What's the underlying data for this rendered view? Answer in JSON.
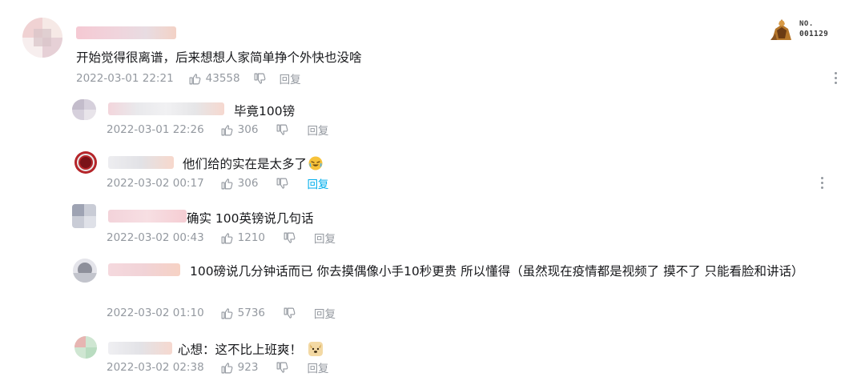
{
  "icons": {
    "like": "thumbs-up-icon",
    "dislike": "thumbs-down-icon",
    "more": "more-vertical-icon"
  },
  "colors": {
    "meta_gray": "#9499a0",
    "reply_hover": "#00aeec",
    "text": "#18191c"
  },
  "fan_badge": {
    "no_label": "NO.",
    "number": "001129"
  },
  "main_comment": {
    "text": "开始觉得很离谱，后来想想人家简单挣个外快也没啥",
    "date": "2022-03-01 22:21",
    "likes": "43558",
    "reply_label": "回复"
  },
  "replies": [
    {
      "text": "毕竟100镑",
      "date": "2022-03-01 22:26",
      "likes": "306",
      "reply_label": "回复"
    },
    {
      "text": "他们给的实在是太多了",
      "emoji": "laughing-tears-emoji",
      "date": "2022-03-02 00:17",
      "likes": "306",
      "reply_label": "回复"
    },
    {
      "text": "确实 100英镑说几句话",
      "date": "2022-03-02 00:43",
      "likes": "1210",
      "reply_label": "回复"
    },
    {
      "text": "100磅说几分钟话而已 你去摸偶像小手10秒更贵 所以懂得（虽然现在疫情都是视频了 摸不了 只能看脸和讲话）",
      "date": "2022-03-02 01:10",
      "likes": "5736",
      "reply_label": "回复"
    },
    {
      "text": "心想：这不比上班爽！",
      "emoji": "doge-emoji",
      "date": "2022-03-02 02:38",
      "likes": "923",
      "reply_label": "回复"
    }
  ]
}
